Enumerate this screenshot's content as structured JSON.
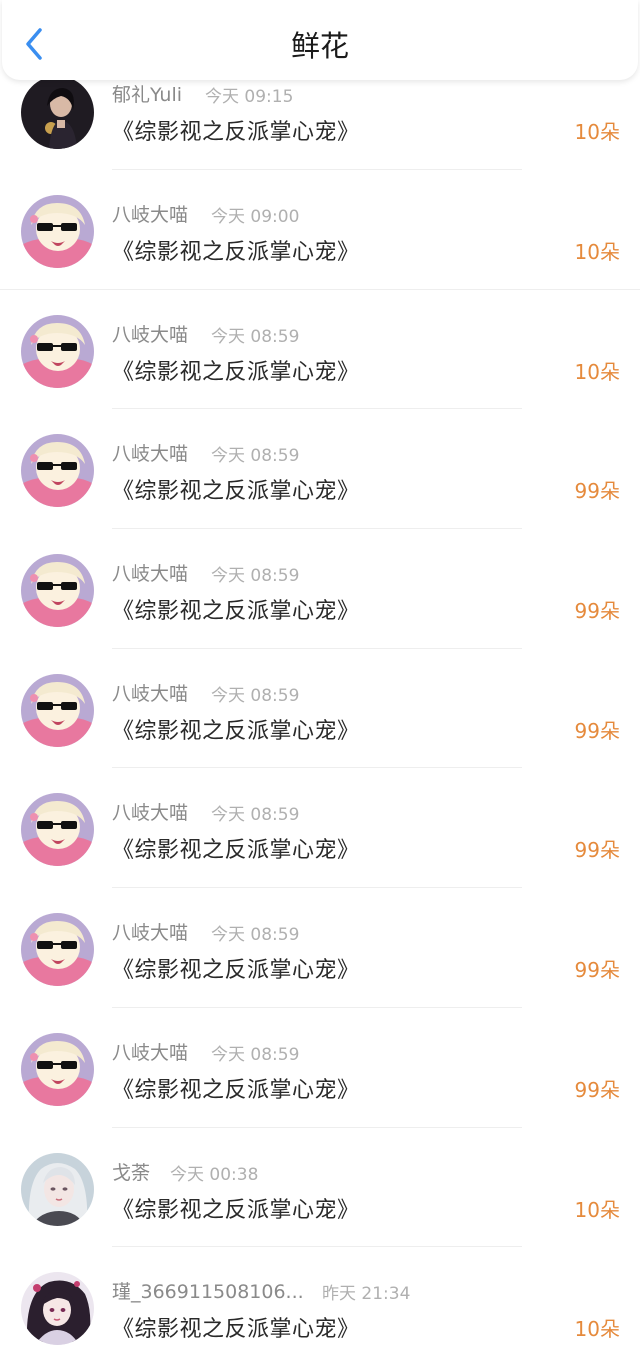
{
  "header": {
    "title": "鲜花",
    "back_icon": "chevron-left-icon",
    "accent_color": "#3a8ef0"
  },
  "colors": {
    "count": "#e58a3c",
    "name": "#8a8a8a",
    "time": "#b0b0b0"
  },
  "items": [
    {
      "name": "郁礼Yuli",
      "time": "今天 09:15",
      "book": "《综影视之反派掌心宠》",
      "count": "10朵",
      "avatar": "photo-girl-avatar"
    },
    {
      "name": "八岐大喵",
      "time": "今天 09:00",
      "book": "《综影视之反派掌心宠》",
      "count": "10朵",
      "avatar": "anime-sunglasses-avatar"
    },
    {
      "name": "八岐大喵",
      "time": "今天 08:59",
      "book": "《综影视之反派掌心宠》",
      "count": "10朵",
      "avatar": "anime-sunglasses-avatar"
    },
    {
      "name": "八岐大喵",
      "time": "今天 08:59",
      "book": "《综影视之反派掌心宠》",
      "count": "99朵",
      "avatar": "anime-sunglasses-avatar"
    },
    {
      "name": "八岐大喵",
      "time": "今天 08:59",
      "book": "《综影视之反派掌心宠》",
      "count": "99朵",
      "avatar": "anime-sunglasses-avatar"
    },
    {
      "name": "八岐大喵",
      "time": "今天 08:59",
      "book": "《综影视之反派掌心宠》",
      "count": "99朵",
      "avatar": "anime-sunglasses-avatar"
    },
    {
      "name": "八岐大喵",
      "time": "今天 08:59",
      "book": "《综影视之反派掌心宠》",
      "count": "99朵",
      "avatar": "anime-sunglasses-avatar"
    },
    {
      "name": "八岐大喵",
      "time": "今天 08:59",
      "book": "《综影视之反派掌心宠》",
      "count": "99朵",
      "avatar": "anime-sunglasses-avatar"
    },
    {
      "name": "八岐大喵",
      "time": "今天 08:59",
      "book": "《综影视之反派掌心宠》",
      "count": "99朵",
      "avatar": "anime-sunglasses-avatar"
    },
    {
      "name": "戈荼",
      "time": "今天 00:38",
      "book": "《综影视之反派掌心宠》",
      "count": "10朵",
      "avatar": "anime-silver-hair-avatar"
    },
    {
      "name": "瑾_366911508106...",
      "time": "昨天 21:34",
      "book": "《综影视之反派掌心宠》",
      "count": "10朵",
      "avatar": "anime-dark-hair-avatar"
    }
  ]
}
